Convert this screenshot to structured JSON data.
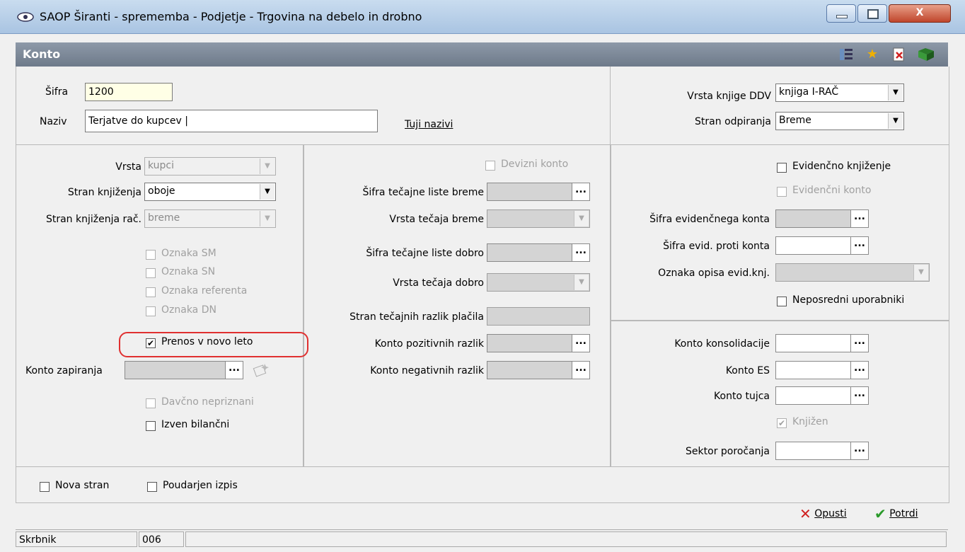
{
  "window": {
    "title": "SAOP  Širanti - sprememba - Podjetje - Trgovina na debelo in drobno",
    "close_glyph": "X"
  },
  "header": {
    "label": "Konto",
    "icons": [
      "properties-icon",
      "favorite-star-icon",
      "delete-icon",
      "book-icon"
    ]
  },
  "top": {
    "sifra_label": "Šifra",
    "sifra_value": "1200",
    "naziv_label": "Naziv",
    "naziv_value": "Terjatve do kupcev |",
    "tuji_nazivi": "Tuji nazivi",
    "vrsta_knjige_label": "Vrsta knjige DDV",
    "vrsta_knjige_value": "knjiga I-RAČ",
    "stran_odpiranja_label": "Stran odpiranja",
    "stran_odpiranja_value": "Breme"
  },
  "left": {
    "vrsta_label": "Vrsta",
    "vrsta_value": "kupci",
    "stran_knjizenja_label": "Stran knjiženja",
    "stran_knjizenja_value": "oboje",
    "stran_knjizenja_rac_label": "Stran knjiženja rač.",
    "stran_knjizenja_rac_value": "breme",
    "oznaka_sm": "Oznaka SM",
    "oznaka_sn": "Oznaka SN",
    "oznaka_referenta": "Oznaka referenta",
    "oznaka_dn": "Oznaka DN",
    "prenos": "Prenos v novo leto",
    "konto_zapiranja_label": "Konto zapiranja",
    "davcno": "Davčno nepriznani",
    "izven": "Izven bilančni"
  },
  "middle": {
    "devizni": "Devizni konto",
    "sifra_tec_breme": "Šifra tečajne liste breme",
    "vrsta_tec_breme": "Vrsta tečaja breme",
    "sifra_tec_dobro": "Šifra tečajne liste dobro",
    "vrsta_tec_dobro": "Vrsta tečaja dobro",
    "stran_tec_razlik": "Stran tečajnih razlik plačila",
    "konto_poz": "Konto pozitivnih razlik",
    "konto_neg": "Konto negativnih razlik"
  },
  "right": {
    "evid_knjizenje": "Evidenčno knjiženje",
    "evid_konto": "Evidenčni konto",
    "sifra_evid_konta": "Šifra evidenčnega konta",
    "sifra_evid_proti": "Šifra evid. proti konta",
    "oznaka_opisa": "Oznaka opisa evid.knj.",
    "neposredni": "Neposredni uporabniki",
    "konto_konsolidacije": "Konto konsolidacije",
    "konto_es": "Konto ES",
    "konto_tujca": "Konto tujca",
    "knjizen": "Knjižen",
    "sektor": "Sektor poročanja"
  },
  "bottom": {
    "nova_stran": "Nova stran",
    "poudarjen": "Poudarjen izpis",
    "opusti": "Opusti",
    "potrdi": "Potrdi"
  },
  "status": {
    "label": "Skrbnik",
    "value": "006"
  },
  "lookup_glyph": "...",
  "check_glyph": "✔"
}
